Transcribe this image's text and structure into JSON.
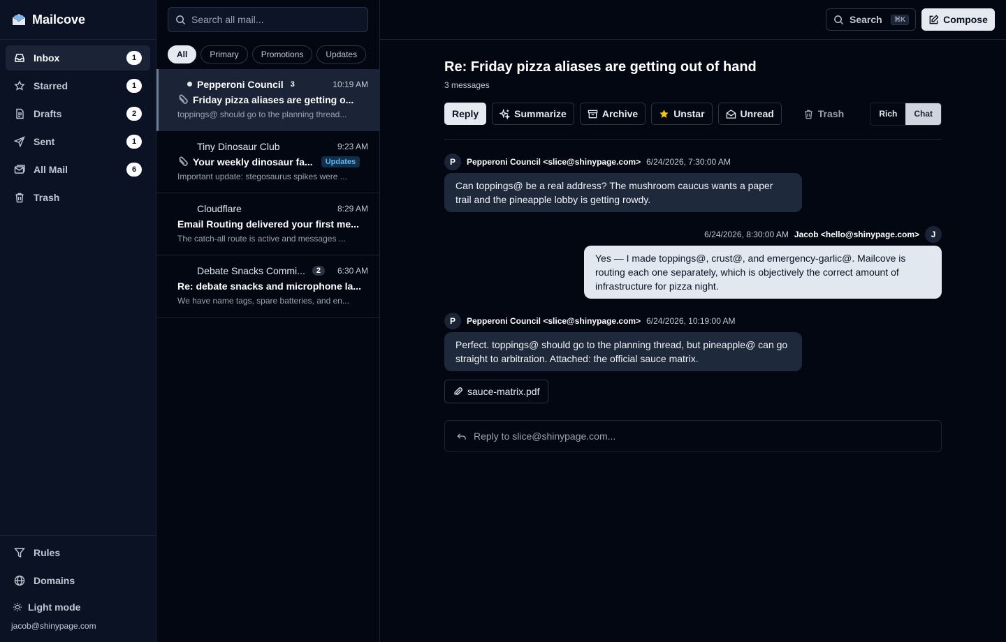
{
  "app": {
    "name": "Mailcove"
  },
  "sidebar": {
    "items": [
      {
        "label": "Inbox",
        "count": "1",
        "icon": "inbox-icon",
        "active": true
      },
      {
        "label": "Starred",
        "count": "1",
        "icon": "star-icon"
      },
      {
        "label": "Drafts",
        "count": "2",
        "icon": "file-icon"
      },
      {
        "label": "Sent",
        "count": "1",
        "icon": "send-icon"
      },
      {
        "label": "All Mail",
        "count": "6",
        "icon": "mail-icon"
      },
      {
        "label": "Trash",
        "count": "",
        "icon": "trash-icon"
      }
    ],
    "bottom": {
      "rules": "Rules",
      "domains": "Domains",
      "light_mode": "Light mode",
      "account_email": "jacob@shinypage.com"
    }
  },
  "list": {
    "search_placeholder": "Search all mail...",
    "filters": [
      "All",
      "Primary",
      "Promotions",
      "Updates"
    ],
    "messages": [
      {
        "from": "Pepperoni Council",
        "count": "3",
        "time": "10:19 AM",
        "subject": "Friday pizza aliases are getting o...",
        "snippet": "toppings@ should go to the planning thread...",
        "unread": true,
        "attachment": true,
        "selected": true
      },
      {
        "from": "Tiny Dinosaur Club",
        "count": "",
        "time": "9:23 AM",
        "subject": "Your weekly dinosaur fa...",
        "tag": "Updates",
        "snippet": "Important update: stegosaurus spikes were ...",
        "attachment": true
      },
      {
        "from": "Cloudflare",
        "count": "",
        "time": "8:29 AM",
        "subject": "Email Routing delivered your first me...",
        "snippet": "The catch-all route is active and messages ..."
      },
      {
        "from": "Debate Snacks Commi...",
        "count": "2",
        "time": "6:30 AM",
        "subject": "Re: debate snacks and microphone la...",
        "snippet": "We have name tags, spare batteries, and en..."
      }
    ]
  },
  "topbar": {
    "search_label": "Search",
    "shortcut": "⌘K",
    "compose_label": "Compose"
  },
  "thread": {
    "title": "Re: Friday pizza aliases are getting out of hand",
    "count_label": "3 messages",
    "actions": {
      "reply": "Reply",
      "summarize": "Summarize",
      "archive": "Archive",
      "unstar": "Unstar",
      "unread": "Unread",
      "trash": "Trash",
      "view_rich": "Rich",
      "view_chat": "Chat"
    },
    "messages": [
      {
        "avatar": "P",
        "from": "Pepperoni Council <slice@shinypage.com>",
        "date": "6/24/2026, 7:30:00 AM",
        "body": "Can toppings@ be a real address? The mushroom caucus wants a paper trail and the pineapple lobby is getting rowdy."
      },
      {
        "avatar": "J",
        "from": "Jacob <hello@shinypage.com>",
        "date": "6/24/2026, 8:30:00 AM",
        "body": "Yes — I made toppings@, crust@, and emergency-garlic@. Mailcove is routing each one separately, which is objectively the correct amount of infrastructure for pizza night."
      },
      {
        "avatar": "P",
        "from": "Pepperoni Council <slice@shinypage.com>",
        "date": "6/24/2026, 10:19:00 AM",
        "body": "Perfect. toppings@ should go to the planning thread, but pineapple@ can go straight to arbitration. Attached: the official sauce matrix."
      }
    ],
    "attachment": "sauce-matrix.pdf",
    "reply_placeholder": "Reply to slice@shinypage.com..."
  }
}
